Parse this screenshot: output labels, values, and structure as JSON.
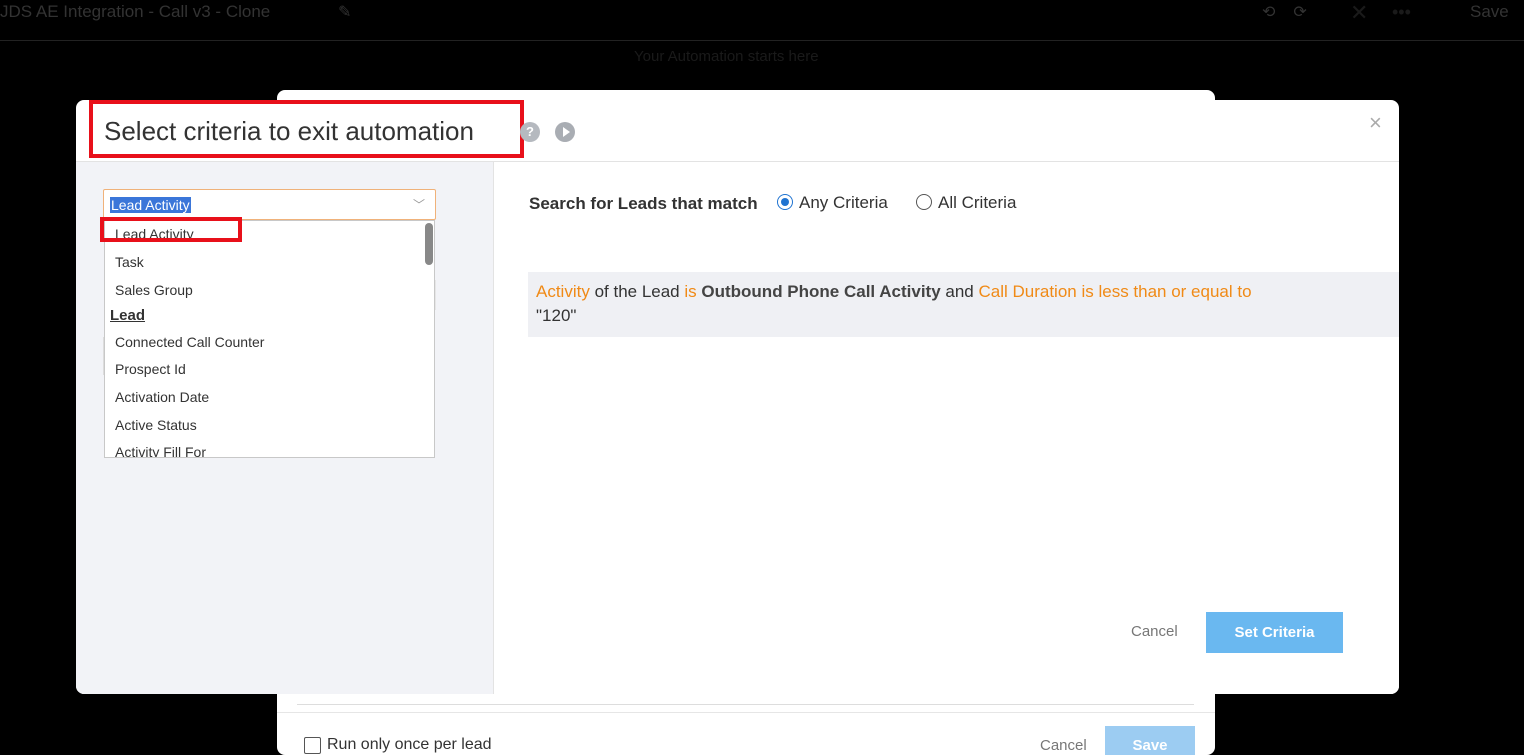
{
  "background": {
    "title": "JDS AE Integration - Call v3 - Clone",
    "save_label": "Save",
    "start_hint": "Your Automation starts here",
    "run_once_label": "Run only once per lead",
    "cancel_label": "Cancel",
    "save_button_label": "Save"
  },
  "modal": {
    "title": "Select criteria to exit automation",
    "help_icon": "?",
    "close_icon": "×",
    "select": {
      "selected": "Lead Activity",
      "options": [
        {
          "label": "Lead Activity"
        },
        {
          "label": "Task"
        },
        {
          "label": "Sales Group"
        }
      ],
      "group_label": "Lead",
      "group_options": [
        {
          "label": "Connected Call Counter"
        },
        {
          "label": "Prospect Id"
        },
        {
          "label": "Activation Date"
        },
        {
          "label": "Active Status"
        },
        {
          "label": "Activity Fill For"
        }
      ]
    },
    "match": {
      "label": "Search for Leads that match",
      "options": [
        {
          "label": "Any Criteria",
          "checked": true
        },
        {
          "label": "All Criteria",
          "checked": false
        }
      ]
    },
    "criteria": {
      "p1": "Activity",
      "p2": " of the Lead ",
      "p3": "is",
      "p4": "Outbound Phone Call Activity",
      "p5": " and ",
      "p6": "Call Duration is less than or equal to",
      "p7": " \"120\""
    },
    "buttons": {
      "cancel": "Cancel",
      "set_criteria": "Set Criteria"
    }
  },
  "colors": {
    "accent": "#1f73d1",
    "keyword_orange": "#f08a16",
    "highlight_red": "#e8101a",
    "primary_button": "#6ab8f0"
  }
}
